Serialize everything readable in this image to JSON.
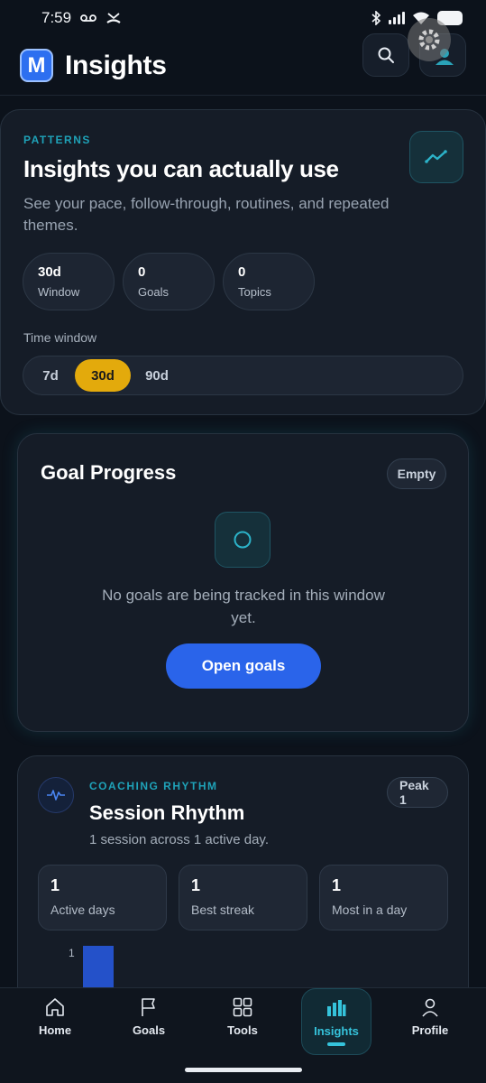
{
  "status": {
    "time": "7:59"
  },
  "header": {
    "logo_letter": "M",
    "title": "Insights"
  },
  "patterns": {
    "kicker": "PATTERNS",
    "title": "Insights you can actually use",
    "description": "See your pace, follow-through, routines, and repeated themes.",
    "stats": [
      {
        "value": "30d",
        "label": "Window"
      },
      {
        "value": "0",
        "label": "Goals"
      },
      {
        "value": "0",
        "label": "Topics"
      }
    ],
    "time_window_label": "Time window",
    "time_window_options": [
      "7d",
      "30d",
      "90d"
    ],
    "selected_window": "30d"
  },
  "goal_progress": {
    "title": "Goal Progress",
    "badge": "Empty",
    "empty_message": "No goals are being tracked in this window yet.",
    "button_label": "Open goals"
  },
  "rhythm": {
    "kicker": "COACHING RHYTHM",
    "title": "Session Rhythm",
    "subtitle": "1 session across 1 active day.",
    "badge": "Peak 1",
    "stats": [
      {
        "value": "1",
        "label": "Active days"
      },
      {
        "value": "1",
        "label": "Best streak"
      },
      {
        "value": "1",
        "label": "Most in a day"
      }
    ],
    "chart_axis_label": "1"
  },
  "chart_data": {
    "type": "bar",
    "categories": [
      ""
    ],
    "values": [
      1
    ],
    "title": "",
    "xlabel": "",
    "ylabel": ""
  },
  "nav": {
    "items": [
      {
        "label": "Home",
        "icon": "home-icon"
      },
      {
        "label": "Goals",
        "icon": "flag-icon"
      },
      {
        "label": "Tools",
        "icon": "grid-icon"
      },
      {
        "label": "Insights",
        "icon": "bar-chart-icon"
      },
      {
        "label": "Profile",
        "icon": "user-icon"
      }
    ],
    "active": "Insights"
  },
  "colors": {
    "accent": "#1fa2b8",
    "primary_button": "#2a64ea",
    "segment_active": "#e3aa0c",
    "chart_bar": "#2451c9"
  }
}
